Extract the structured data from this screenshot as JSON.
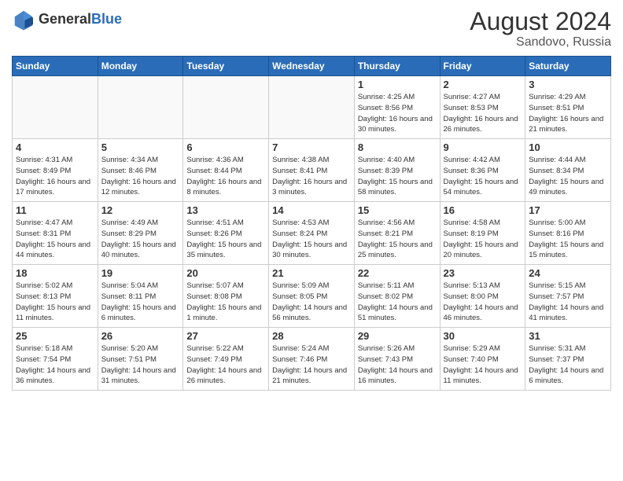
{
  "header": {
    "logo_general": "General",
    "logo_blue": "Blue",
    "month_year": "August 2024",
    "location": "Sandovo, Russia"
  },
  "days_of_week": [
    "Sunday",
    "Monday",
    "Tuesday",
    "Wednesday",
    "Thursday",
    "Friday",
    "Saturday"
  ],
  "weeks": [
    [
      {
        "day": "",
        "sunrise": "",
        "sunset": "",
        "daylight": "",
        "empty": true
      },
      {
        "day": "",
        "sunrise": "",
        "sunset": "",
        "daylight": "",
        "empty": true
      },
      {
        "day": "",
        "sunrise": "",
        "sunset": "",
        "daylight": "",
        "empty": true
      },
      {
        "day": "",
        "sunrise": "",
        "sunset": "",
        "daylight": "",
        "empty": true
      },
      {
        "day": "1",
        "sunrise": "Sunrise: 4:25 AM",
        "sunset": "Sunset: 8:56 PM",
        "daylight": "Daylight: 16 hours and 30 minutes.",
        "empty": false
      },
      {
        "day": "2",
        "sunrise": "Sunrise: 4:27 AM",
        "sunset": "Sunset: 8:53 PM",
        "daylight": "Daylight: 16 hours and 26 minutes.",
        "empty": false
      },
      {
        "day": "3",
        "sunrise": "Sunrise: 4:29 AM",
        "sunset": "Sunset: 8:51 PM",
        "daylight": "Daylight: 16 hours and 21 minutes.",
        "empty": false
      }
    ],
    [
      {
        "day": "4",
        "sunrise": "Sunrise: 4:31 AM",
        "sunset": "Sunset: 8:49 PM",
        "daylight": "Daylight: 16 hours and 17 minutes.",
        "empty": false
      },
      {
        "day": "5",
        "sunrise": "Sunrise: 4:34 AM",
        "sunset": "Sunset: 8:46 PM",
        "daylight": "Daylight: 16 hours and 12 minutes.",
        "empty": false
      },
      {
        "day": "6",
        "sunrise": "Sunrise: 4:36 AM",
        "sunset": "Sunset: 8:44 PM",
        "daylight": "Daylight: 16 hours and 8 minutes.",
        "empty": false
      },
      {
        "day": "7",
        "sunrise": "Sunrise: 4:38 AM",
        "sunset": "Sunset: 8:41 PM",
        "daylight": "Daylight: 16 hours and 3 minutes.",
        "empty": false
      },
      {
        "day": "8",
        "sunrise": "Sunrise: 4:40 AM",
        "sunset": "Sunset: 8:39 PM",
        "daylight": "Daylight: 15 hours and 58 minutes.",
        "empty": false
      },
      {
        "day": "9",
        "sunrise": "Sunrise: 4:42 AM",
        "sunset": "Sunset: 8:36 PM",
        "daylight": "Daylight: 15 hours and 54 minutes.",
        "empty": false
      },
      {
        "day": "10",
        "sunrise": "Sunrise: 4:44 AM",
        "sunset": "Sunset: 8:34 PM",
        "daylight": "Daylight: 15 hours and 49 minutes.",
        "empty": false
      }
    ],
    [
      {
        "day": "11",
        "sunrise": "Sunrise: 4:47 AM",
        "sunset": "Sunset: 8:31 PM",
        "daylight": "Daylight: 15 hours and 44 minutes.",
        "empty": false
      },
      {
        "day": "12",
        "sunrise": "Sunrise: 4:49 AM",
        "sunset": "Sunset: 8:29 PM",
        "daylight": "Daylight: 15 hours and 40 minutes.",
        "empty": false
      },
      {
        "day": "13",
        "sunrise": "Sunrise: 4:51 AM",
        "sunset": "Sunset: 8:26 PM",
        "daylight": "Daylight: 15 hours and 35 minutes.",
        "empty": false
      },
      {
        "day": "14",
        "sunrise": "Sunrise: 4:53 AM",
        "sunset": "Sunset: 8:24 PM",
        "daylight": "Daylight: 15 hours and 30 minutes.",
        "empty": false
      },
      {
        "day": "15",
        "sunrise": "Sunrise: 4:56 AM",
        "sunset": "Sunset: 8:21 PM",
        "daylight": "Daylight: 15 hours and 25 minutes.",
        "empty": false
      },
      {
        "day": "16",
        "sunrise": "Sunrise: 4:58 AM",
        "sunset": "Sunset: 8:19 PM",
        "daylight": "Daylight: 15 hours and 20 minutes.",
        "empty": false
      },
      {
        "day": "17",
        "sunrise": "Sunrise: 5:00 AM",
        "sunset": "Sunset: 8:16 PM",
        "daylight": "Daylight: 15 hours and 15 minutes.",
        "empty": false
      }
    ],
    [
      {
        "day": "18",
        "sunrise": "Sunrise: 5:02 AM",
        "sunset": "Sunset: 8:13 PM",
        "daylight": "Daylight: 15 hours and 11 minutes.",
        "empty": false
      },
      {
        "day": "19",
        "sunrise": "Sunrise: 5:04 AM",
        "sunset": "Sunset: 8:11 PM",
        "daylight": "Daylight: 15 hours and 6 minutes.",
        "empty": false
      },
      {
        "day": "20",
        "sunrise": "Sunrise: 5:07 AM",
        "sunset": "Sunset: 8:08 PM",
        "daylight": "Daylight: 15 hours and 1 minute.",
        "empty": false
      },
      {
        "day": "21",
        "sunrise": "Sunrise: 5:09 AM",
        "sunset": "Sunset: 8:05 PM",
        "daylight": "Daylight: 14 hours and 56 minutes.",
        "empty": false
      },
      {
        "day": "22",
        "sunrise": "Sunrise: 5:11 AM",
        "sunset": "Sunset: 8:02 PM",
        "daylight": "Daylight: 14 hours and 51 minutes.",
        "empty": false
      },
      {
        "day": "23",
        "sunrise": "Sunrise: 5:13 AM",
        "sunset": "Sunset: 8:00 PM",
        "daylight": "Daylight: 14 hours and 46 minutes.",
        "empty": false
      },
      {
        "day": "24",
        "sunrise": "Sunrise: 5:15 AM",
        "sunset": "Sunset: 7:57 PM",
        "daylight": "Daylight: 14 hours and 41 minutes.",
        "empty": false
      }
    ],
    [
      {
        "day": "25",
        "sunrise": "Sunrise: 5:18 AM",
        "sunset": "Sunset: 7:54 PM",
        "daylight": "Daylight: 14 hours and 36 minutes.",
        "empty": false
      },
      {
        "day": "26",
        "sunrise": "Sunrise: 5:20 AM",
        "sunset": "Sunset: 7:51 PM",
        "daylight": "Daylight: 14 hours and 31 minutes.",
        "empty": false
      },
      {
        "day": "27",
        "sunrise": "Sunrise: 5:22 AM",
        "sunset": "Sunset: 7:49 PM",
        "daylight": "Daylight: 14 hours and 26 minutes.",
        "empty": false
      },
      {
        "day": "28",
        "sunrise": "Sunrise: 5:24 AM",
        "sunset": "Sunset: 7:46 PM",
        "daylight": "Daylight: 14 hours and 21 minutes.",
        "empty": false
      },
      {
        "day": "29",
        "sunrise": "Sunrise: 5:26 AM",
        "sunset": "Sunset: 7:43 PM",
        "daylight": "Daylight: 14 hours and 16 minutes.",
        "empty": false
      },
      {
        "day": "30",
        "sunrise": "Sunrise: 5:29 AM",
        "sunset": "Sunset: 7:40 PM",
        "daylight": "Daylight: 14 hours and 11 minutes.",
        "empty": false
      },
      {
        "day": "31",
        "sunrise": "Sunrise: 5:31 AM",
        "sunset": "Sunset: 7:37 PM",
        "daylight": "Daylight: 14 hours and 6 minutes.",
        "empty": false
      }
    ]
  ]
}
